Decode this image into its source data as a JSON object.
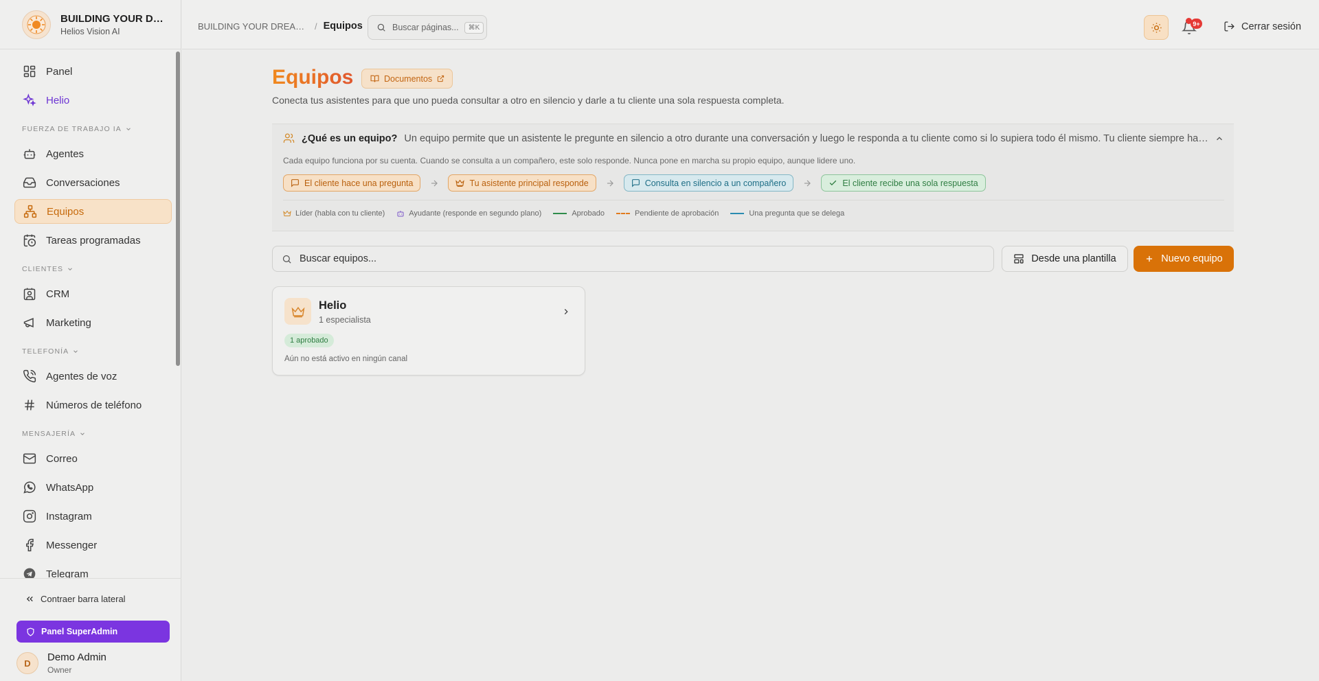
{
  "brand": {
    "name": "BUILDING YOUR DREAMS TOGETHER",
    "subtitle": "Helios Vision AI"
  },
  "nav": {
    "panel": "Panel",
    "helio": "Helio",
    "sections": {
      "workforce": "FUERZA DE TRABAJO IA",
      "clients": "CLIENTES",
      "telephony": "TELEFONÍA",
      "messaging": "MENSAJERÍA"
    },
    "items": {
      "agents": "Agentes",
      "conversations": "Conversaciones",
      "teams": "Equipos",
      "scheduled": "Tareas programadas",
      "crm": "CRM",
      "marketing": "Marketing",
      "voice_agents": "Agentes de voz",
      "phone_numbers": "Números de teléfono",
      "email": "Correo",
      "whatsapp": "WhatsApp",
      "instagram": "Instagram",
      "messenger": "Messenger",
      "telegram": "Telegram"
    }
  },
  "sidebar_bottom": {
    "collapse": "Contraer barra lateral",
    "superadmin": "Panel SuperAdmin",
    "user": {
      "initial": "D",
      "name": "Demo Admin",
      "role": "Owner"
    }
  },
  "topbar": {
    "breadcrumb_org": "BUILDING YOUR DREAMS TOGETHER",
    "breadcrumb_sep": "/",
    "breadcrumb_current": "Equipos",
    "search_placeholder": "Buscar páginas...",
    "search_shortcut": "⌘K",
    "notifications_count": "9+",
    "logout": "Cerrar sesión"
  },
  "page": {
    "title": "Equipos",
    "docs_button": "Documentos",
    "subtitle": "Conecta tus asistentes para que uno pueda consultar a otro en silencio y darle a tu cliente una sola respuesta completa."
  },
  "info": {
    "question": "¿Qué es un equipo?",
    "description": "Un equipo permite que un asistente le pregunte en silencio a otro durante una conversación y luego le responda a tu cliente como si lo supiera todo él mismo. Tu cliente siempre habla con el asistente principal.",
    "note": "Cada equipo funciona por su cuenta. Cuando se consulta a un compañero, este solo responde. Nunca pone en marcha su propio equipo, aunque lidere uno.",
    "flow": [
      "El cliente hace una pregunta",
      "Tu asistente principal responde",
      "Consulta en silencio a un compañero",
      "El cliente recibe una sola respuesta"
    ],
    "legend": {
      "leader": "Líder (habla con tu cliente)",
      "helper": "Ayudante (responde en segundo plano)",
      "approved": "Aprobado",
      "pending": "Pendiente de aprobación",
      "delegated": "Una pregunta que se delega"
    }
  },
  "toolbar": {
    "search_placeholder": "Buscar equipos...",
    "template_button": "Desde una plantilla",
    "new_button": "Nuevo equipo"
  },
  "teams": [
    {
      "name": "Helio",
      "members": "1 especialista",
      "status_badge": "1 aprobado",
      "channel_note": "Aún no está activo en ningún canal"
    }
  ],
  "colors": {
    "accent": "#d97208",
    "helio_purple": "#6d35d3",
    "superadmin": "#7b35e0"
  }
}
